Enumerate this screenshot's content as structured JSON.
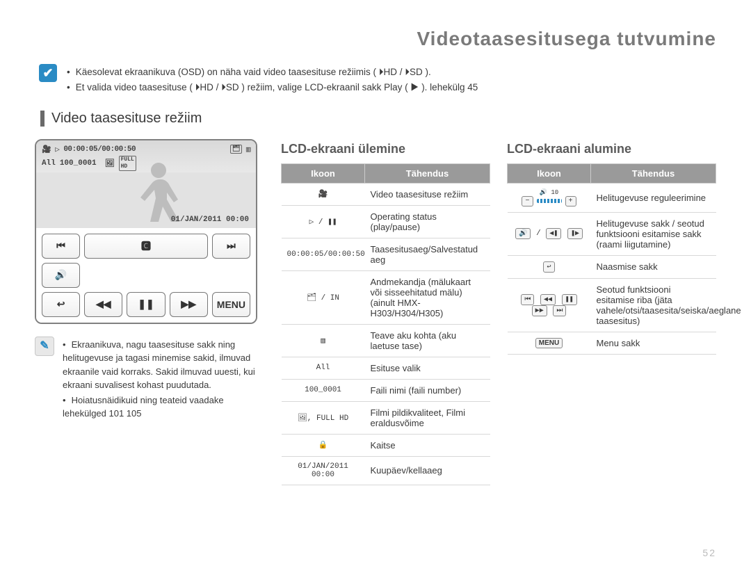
{
  "page_title": "Videotaasesitusega tutvumine",
  "info": {
    "line1": "Käesolevat ekraanikuva (OSD) on näha vaid video taasesituse režiimis ( ⏵HD / ⏵SD ).",
    "line2": "Et valida video taasesituse ( ⏵HD / ⏵SD ) režiim, valige LCD-ekraanil sakk Play ( ▶ ). lehekülg 45"
  },
  "section_heading": "Video taasesituse režiim",
  "lcd": {
    "time_counter": "00:00:05/00:00:50",
    "file_label": "100_0001",
    "all_label": "All",
    "datetime": "01/JAN/2011 00:00",
    "menu_label": "MENU",
    "icons": {
      "prev": "⏮",
      "cc": "🅲",
      "next": "⏭",
      "vol": "🔊",
      "back": "↩",
      "rew": "◀◀",
      "pause": "❚❚",
      "ffwd": "▶▶"
    }
  },
  "note": {
    "line1": "Ekraanikuva, nagu taasesituse sakk ning helitugevuse ja tagasi minemise sakid, ilmuvad ekraanile vaid korraks. Sakid ilmuvad uuesti, kui ekraani suvalisest kohast puudutada.",
    "line2": "Hoiatusnäidikuid ning  teateid vaadake lehekülged 101 105"
  },
  "table_left": {
    "title": "LCD-ekraani ülemine",
    "headers": {
      "icon": "Ikoon",
      "meaning": "Tähendus"
    },
    "rows": [
      {
        "icon_text": "",
        "icon_html": "mode",
        "meaning": "Video taasesituse režiim"
      },
      {
        "icon_text": "▷ / ❚❚",
        "meaning": "Operating status (play/pause)"
      },
      {
        "icon_text": "00:00:05/00:00:50",
        "meaning": "Taasesitusaeg/Salvestatud aeg"
      },
      {
        "icon_text": "🗂 / IN",
        "meaning": "Andmekandja (mälukaart või sisseehitatud mälu) (ainult HMX-H303/H304/H305)"
      },
      {
        "icon_text": "▥",
        "meaning": "Teave aku kohta (aku laetuse tase)"
      },
      {
        "icon_text": "All",
        "meaning": "Esituse valik"
      },
      {
        "icon_text": "100_0001",
        "meaning": "Faili nimi (faili number)"
      },
      {
        "icon_text": "🖼, FULL HD",
        "meaning": "Filmi pildikvaliteet, Filmi eraldusvõime"
      },
      {
        "icon_text": "🔒",
        "meaning": "Kaitse"
      },
      {
        "icon_text": "01/JAN/2011 00:00",
        "meaning": "Kuupäev/kellaaeg"
      }
    ]
  },
  "table_right": {
    "title": "LCD-ekraani alumine",
    "headers": {
      "icon": "Ikoon",
      "meaning": "Tähendus"
    },
    "rows": [
      {
        "icon_html": "volume",
        "meaning": "Helitugevuse reguleerimine"
      },
      {
        "icon_html": "tabs",
        "meaning": "Helitugevuse sakk / seotud funktsiooni esitamise sakk (raami liigutamine)"
      },
      {
        "icon_html": "back",
        "meaning": "Naasmise sakk"
      },
      {
        "icon_html": "transport",
        "meaning": "Seotud funktsiooni esitamise riba (jäta vahele/otsi/taasesita/seiska/aeglane taasesitus)"
      },
      {
        "icon_html": "menu",
        "meaning": "Menu sakk"
      }
    ]
  },
  "page_number": "52"
}
